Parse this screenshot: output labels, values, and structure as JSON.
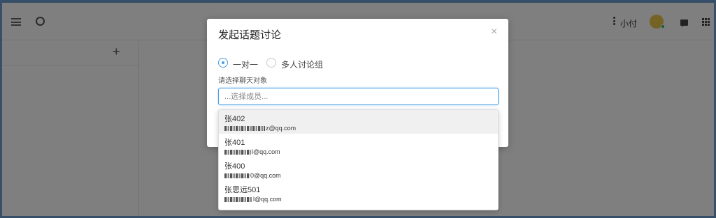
{
  "topbar": {
    "username": "小付"
  },
  "dialog": {
    "title": "发起话题讨论",
    "close_glyph": "×",
    "radios": [
      {
        "label": "一对一",
        "checked": true
      },
      {
        "label": "多人讨论组",
        "checked": false
      }
    ],
    "field_label": "请选择聊天对象",
    "input_placeholder": "...选择成员..."
  },
  "dropdown": {
    "items": [
      {
        "name": "张402",
        "email_suffix": "z@qq.com",
        "active": true
      },
      {
        "name": "张401",
        "email_suffix": "l@qq.com",
        "active": false
      },
      {
        "name": "张400",
        "email_suffix": "0@qq.com",
        "active": false
      },
      {
        "name": "张思远501",
        "email_suffix": "l@qq.com",
        "active": false
      }
    ]
  },
  "colors": {
    "accent": "#4aa0e8",
    "overlay": "rgba(0,0,0,0.5)",
    "avatar": "#e8c74a",
    "online": "#2fbd6c"
  },
  "icons": [
    "menu-icon",
    "clock-icon",
    "kebab-icon",
    "chat-icon",
    "apps-grid-icon",
    "plus-icon",
    "close-icon"
  ]
}
